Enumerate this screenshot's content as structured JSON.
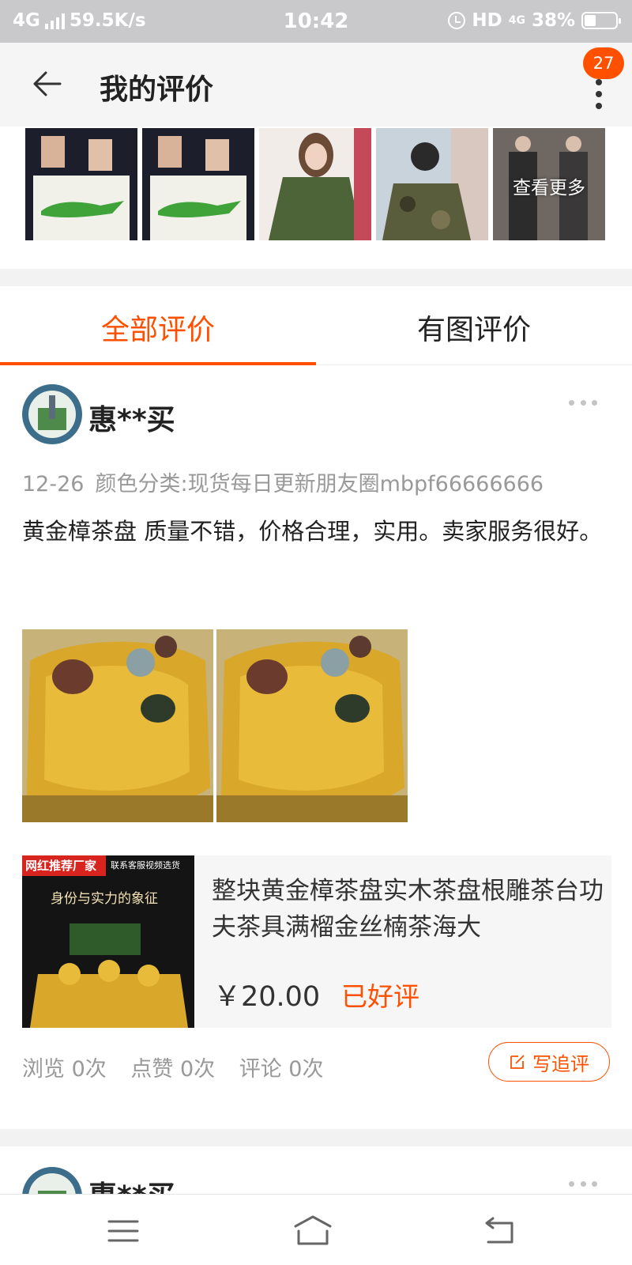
{
  "status_bar": {
    "network": "4G",
    "speed": "59.5K/s",
    "time": "10:42",
    "hd": "HD",
    "net2": "4G",
    "battery": "38%",
    "battery_level": 0.38
  },
  "nav": {
    "title": "我的评价",
    "badge": "27"
  },
  "gallery": {
    "more_label": "查看更多",
    "thumbs": [
      "toy-box-photo",
      "toy-box-photo",
      "green-jacket-photo",
      "camo-jacket-photo",
      "coat-photo"
    ]
  },
  "tabs": {
    "all": "全部评价",
    "with_images": "有图评价"
  },
  "review": {
    "user": "惠**买",
    "date": "12-26",
    "spec": "颜色分类:现货每日更新朋友圈mbpf66666666",
    "text": "黄金樟茶盘 质量不错，价格合理，实用。卖家服务很好。",
    "images": [
      "tea-tray-photo",
      "tea-tray-photo"
    ],
    "product": {
      "title": "整块黄金樟茶盘实木茶盘根雕茶台功夫茶具满榴金丝楠茶海大",
      "price": "￥20.00",
      "rating_status": "已好评",
      "banner_tag": "网红推荐厂家",
      "banner_sub": "联系客服视频选货",
      "banner_slogan": "身份与实力的象征"
    },
    "stats": {
      "views": "浏览 0次",
      "likes": "点赞 0次",
      "comments": "评论 0次"
    },
    "follow_up_button": "写追评"
  },
  "review2": {
    "user": "惠**买"
  },
  "colors": {
    "accent": "#ff5000",
    "status_bar": "#c9c9cc"
  }
}
